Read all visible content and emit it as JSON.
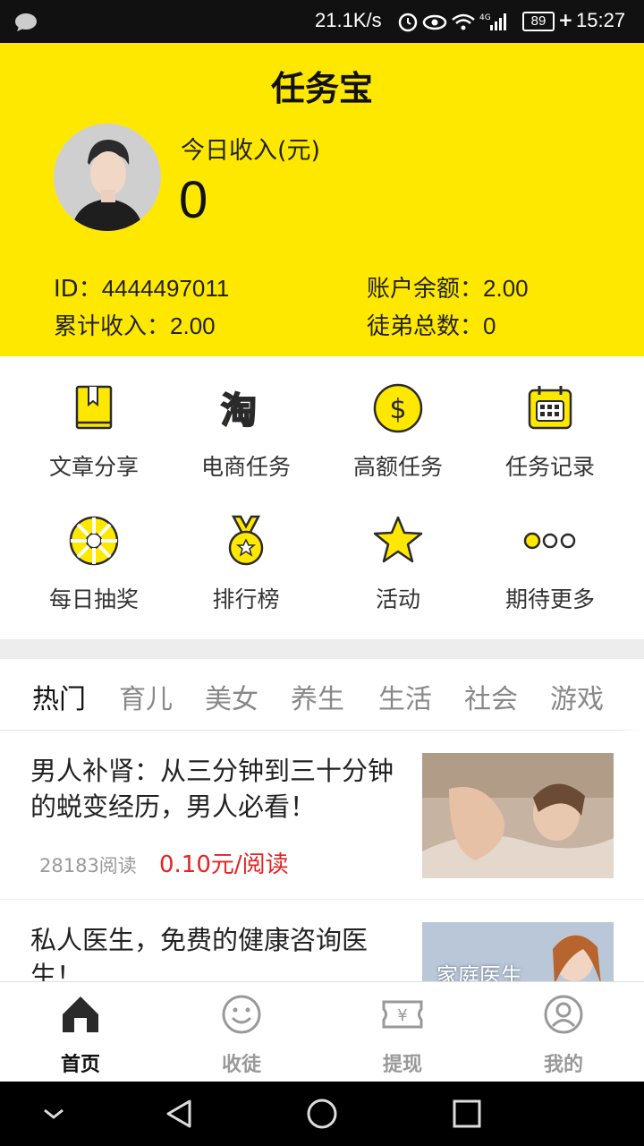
{
  "status_bar": {
    "speed": "21.1K/s",
    "battery": "89",
    "time": "15:27",
    "icons": [
      "message-icon",
      "alarm-icon",
      "eye-icon",
      "wifi-icon",
      "4g-signal-icon"
    ]
  },
  "header": {
    "title": "任务宝",
    "income_label": "今日收入(元)",
    "income_value": "0",
    "id_label": "ID：",
    "id_value": "4444497011",
    "balance_label": "账户余额：",
    "balance_value": "2.00",
    "total_label": "累计收入：",
    "total_value": "2.00",
    "apprentices_label": "徒弟总数：",
    "apprentices_value": "0"
  },
  "menu": [
    {
      "label": "文章分享",
      "icon": "book-icon"
    },
    {
      "label": "电商任务",
      "icon": "taobao-icon"
    },
    {
      "label": "高额任务",
      "icon": "dollar-icon"
    },
    {
      "label": "任务记录",
      "icon": "calendar-icon"
    },
    {
      "label": "每日抽奖",
      "icon": "lottery-wheel-icon"
    },
    {
      "label": "排行榜",
      "icon": "medal-icon"
    },
    {
      "label": "活动",
      "icon": "star-icon"
    },
    {
      "label": "期待更多",
      "icon": "more-dots-icon"
    }
  ],
  "tabs": [
    "热门",
    "育儿",
    "美女",
    "养生",
    "生活",
    "社会",
    "游戏"
  ],
  "active_tab": "热门",
  "articles": [
    {
      "title": "男人补肾：从三分钟到三十分钟的蜕变经历，男人必看！",
      "reads": "28183阅读",
      "price": "0.10元/阅读"
    },
    {
      "title": "私人医生，免费的健康咨询医生！",
      "thumb_text": "家庭医生"
    }
  ],
  "bottom_nav": [
    {
      "label": "首页",
      "icon": "home-icon"
    },
    {
      "label": "收徒",
      "icon": "smiley-icon"
    },
    {
      "label": "提现",
      "icon": "ticket-yen-icon"
    },
    {
      "label": "我的",
      "icon": "user-icon"
    }
  ],
  "colors": {
    "accent": "#ffe800",
    "price": "#e52222",
    "icon_fill": "#ffe800",
    "icon_stroke": "#2a2a2a"
  }
}
